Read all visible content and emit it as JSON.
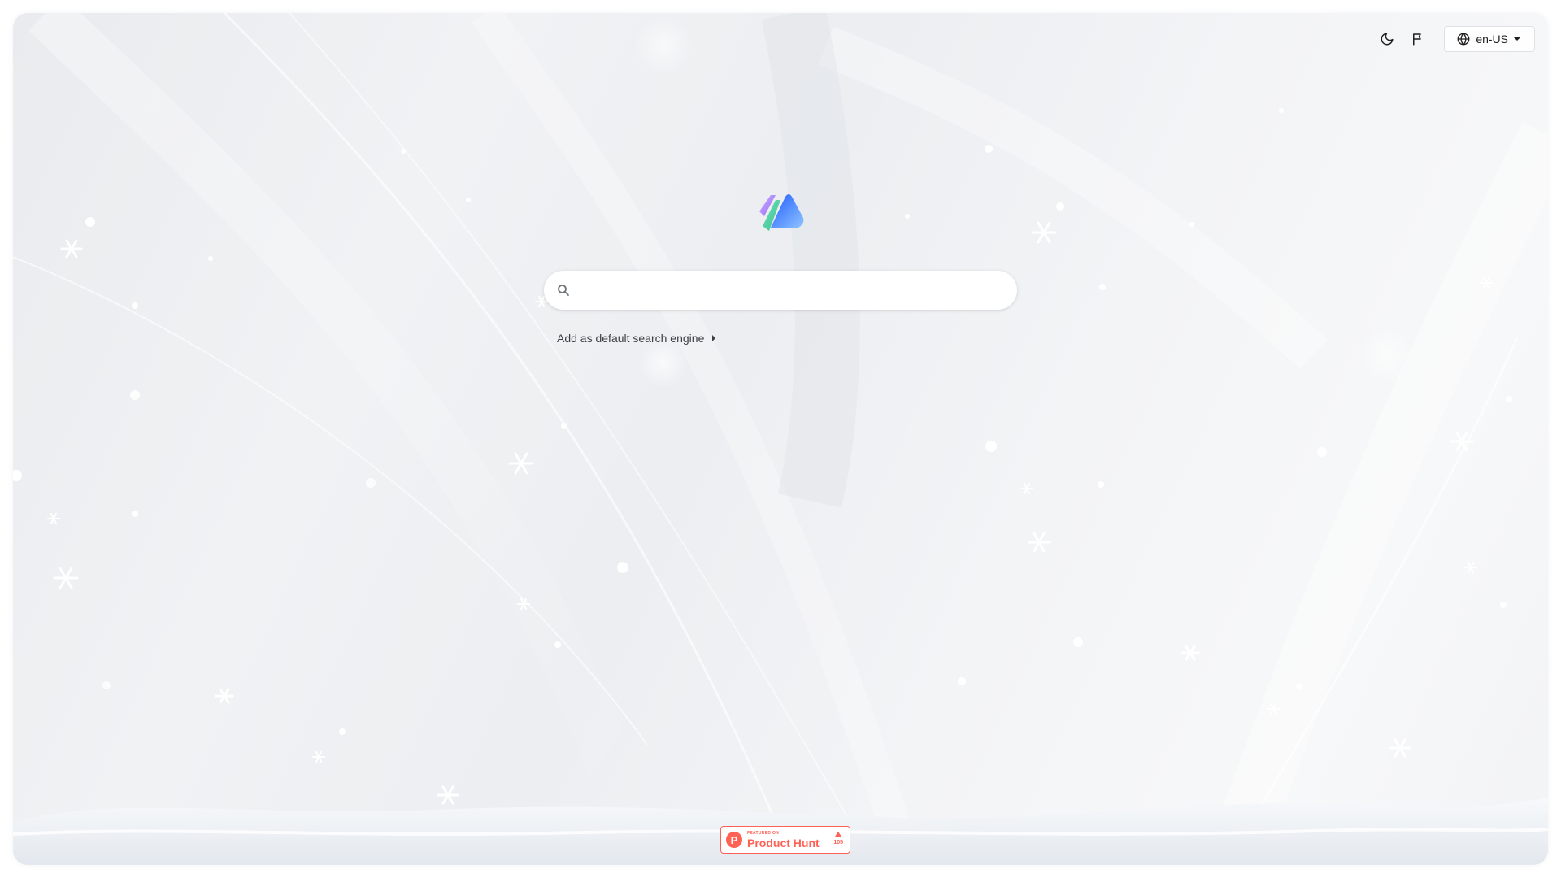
{
  "toolbar": {
    "theme_icon": "moon-icon",
    "feedback_icon": "flag-icon",
    "language": {
      "icon": "globe-icon",
      "label": "en-US",
      "dropdown_icon": "caret-down-icon"
    }
  },
  "logo": {
    "icon": "app-logo",
    "colors": [
      "#9b6bff",
      "#3ecf8e",
      "#2f6bff",
      "#64a8ff"
    ]
  },
  "search": {
    "icon": "search-icon",
    "value": "",
    "placeholder": ""
  },
  "default_engine": {
    "label": "Add as default search engine",
    "icon": "caret-right-icon"
  },
  "product_hunt": {
    "featured_label": "FEATURED ON",
    "name": "Product Hunt",
    "votes": "105",
    "brand_color": "#ff6154"
  }
}
